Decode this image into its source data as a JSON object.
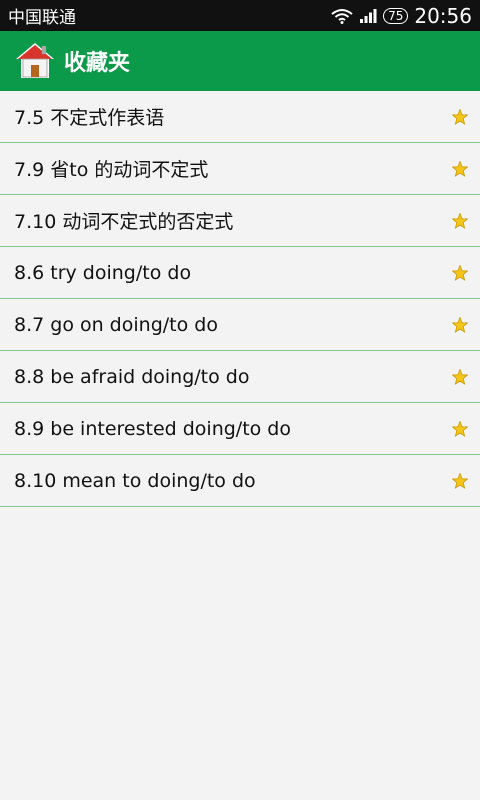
{
  "status": {
    "carrier": "中国联通",
    "battery": "75",
    "time": "20:56"
  },
  "appbar": {
    "title": "收藏夹",
    "icon": "home-icon"
  },
  "favorites": [
    {
      "label": "7.5 不定式作表语"
    },
    {
      "label": "7.9 省to 的动词不定式"
    },
    {
      "label": "7.10 动词不定式的否定式"
    },
    {
      "label": "8.6 try doing/to do"
    },
    {
      "label": "8.7 go on doing/to do"
    },
    {
      "label": "8.8 be afraid doing/to do"
    },
    {
      "label": "8.9 be interested doing/to do"
    },
    {
      "label": "8.10 mean to doing/to do"
    }
  ],
  "colors": {
    "appbar": "#0b9a4a",
    "divider": "#7dc98f",
    "star": "#f5c518"
  }
}
